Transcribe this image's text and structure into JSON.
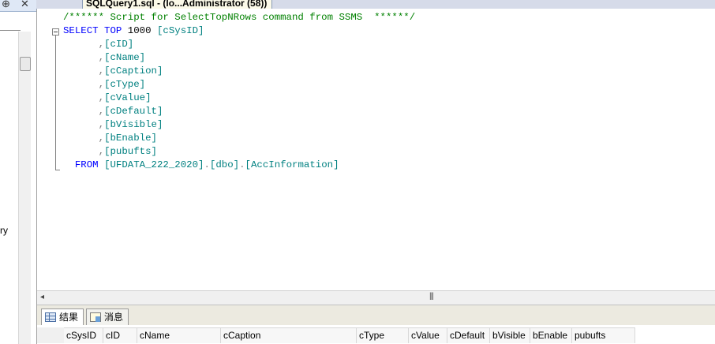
{
  "left_pane": {
    "pin_glyph": "⊕",
    "close_glyph": "✕",
    "cut_label": "ry"
  },
  "tab": {
    "title": "SQLQuery1.sql - (lo...Administrator (58))"
  },
  "editor": {
    "lines": [
      {
        "parts": [
          {
            "t": "/****** Script for SelectTopNRows command from SSMS  ******/",
            "c": "cm"
          }
        ]
      },
      {
        "parts": [
          {
            "t": "SELECT TOP ",
            "c": "kw"
          },
          {
            "t": "1000 ",
            "c": "plain"
          },
          {
            "t": "[cSysID]",
            "c": "id"
          }
        ]
      },
      {
        "parts": [
          {
            "t": "      ,",
            "c": "gr"
          },
          {
            "t": "[cID]",
            "c": "id"
          }
        ]
      },
      {
        "parts": [
          {
            "t": "      ,",
            "c": "gr"
          },
          {
            "t": "[cName]",
            "c": "id"
          }
        ]
      },
      {
        "parts": [
          {
            "t": "      ,",
            "c": "gr"
          },
          {
            "t": "[cCaption]",
            "c": "id"
          }
        ]
      },
      {
        "parts": [
          {
            "t": "      ,",
            "c": "gr"
          },
          {
            "t": "[cType]",
            "c": "id"
          }
        ]
      },
      {
        "parts": [
          {
            "t": "      ,",
            "c": "gr"
          },
          {
            "t": "[cValue]",
            "c": "id"
          }
        ]
      },
      {
        "parts": [
          {
            "t": "      ,",
            "c": "gr"
          },
          {
            "t": "[cDefault]",
            "c": "id"
          }
        ]
      },
      {
        "parts": [
          {
            "t": "      ,",
            "c": "gr"
          },
          {
            "t": "[bVisible]",
            "c": "id"
          }
        ]
      },
      {
        "parts": [
          {
            "t": "      ,",
            "c": "gr"
          },
          {
            "t": "[bEnable]",
            "c": "id"
          }
        ]
      },
      {
        "parts": [
          {
            "t": "      ,",
            "c": "gr"
          },
          {
            "t": "[pubufts]",
            "c": "id"
          }
        ]
      },
      {
        "parts": [
          {
            "t": "  FROM ",
            "c": "kw"
          },
          {
            "t": "[UFDATA_222_2020]",
            "c": "id"
          },
          {
            "t": ".",
            "c": "gr"
          },
          {
            "t": "[dbo]",
            "c": "id"
          },
          {
            "t": ".",
            "c": "gr"
          },
          {
            "t": "[AccInformation]",
            "c": "id"
          }
        ]
      }
    ]
  },
  "hscroll": {
    "left_arrow": "◂",
    "grip": "|||"
  },
  "results": {
    "tabs": [
      {
        "label": "结果",
        "icon": "grid-icon",
        "active": true
      },
      {
        "label": "消息",
        "icon": "messages-icon",
        "active": false
      }
    ],
    "columns": [
      "cSysID",
      "cID",
      "cName",
      "cCaption",
      "cType",
      "cValue",
      "cDefault",
      "bVisible",
      "bEnable",
      "pubufts"
    ]
  },
  "colors": {
    "keyword": "#0000ff",
    "comment": "#008000",
    "identifier": "#008080",
    "operator": "#808080"
  }
}
